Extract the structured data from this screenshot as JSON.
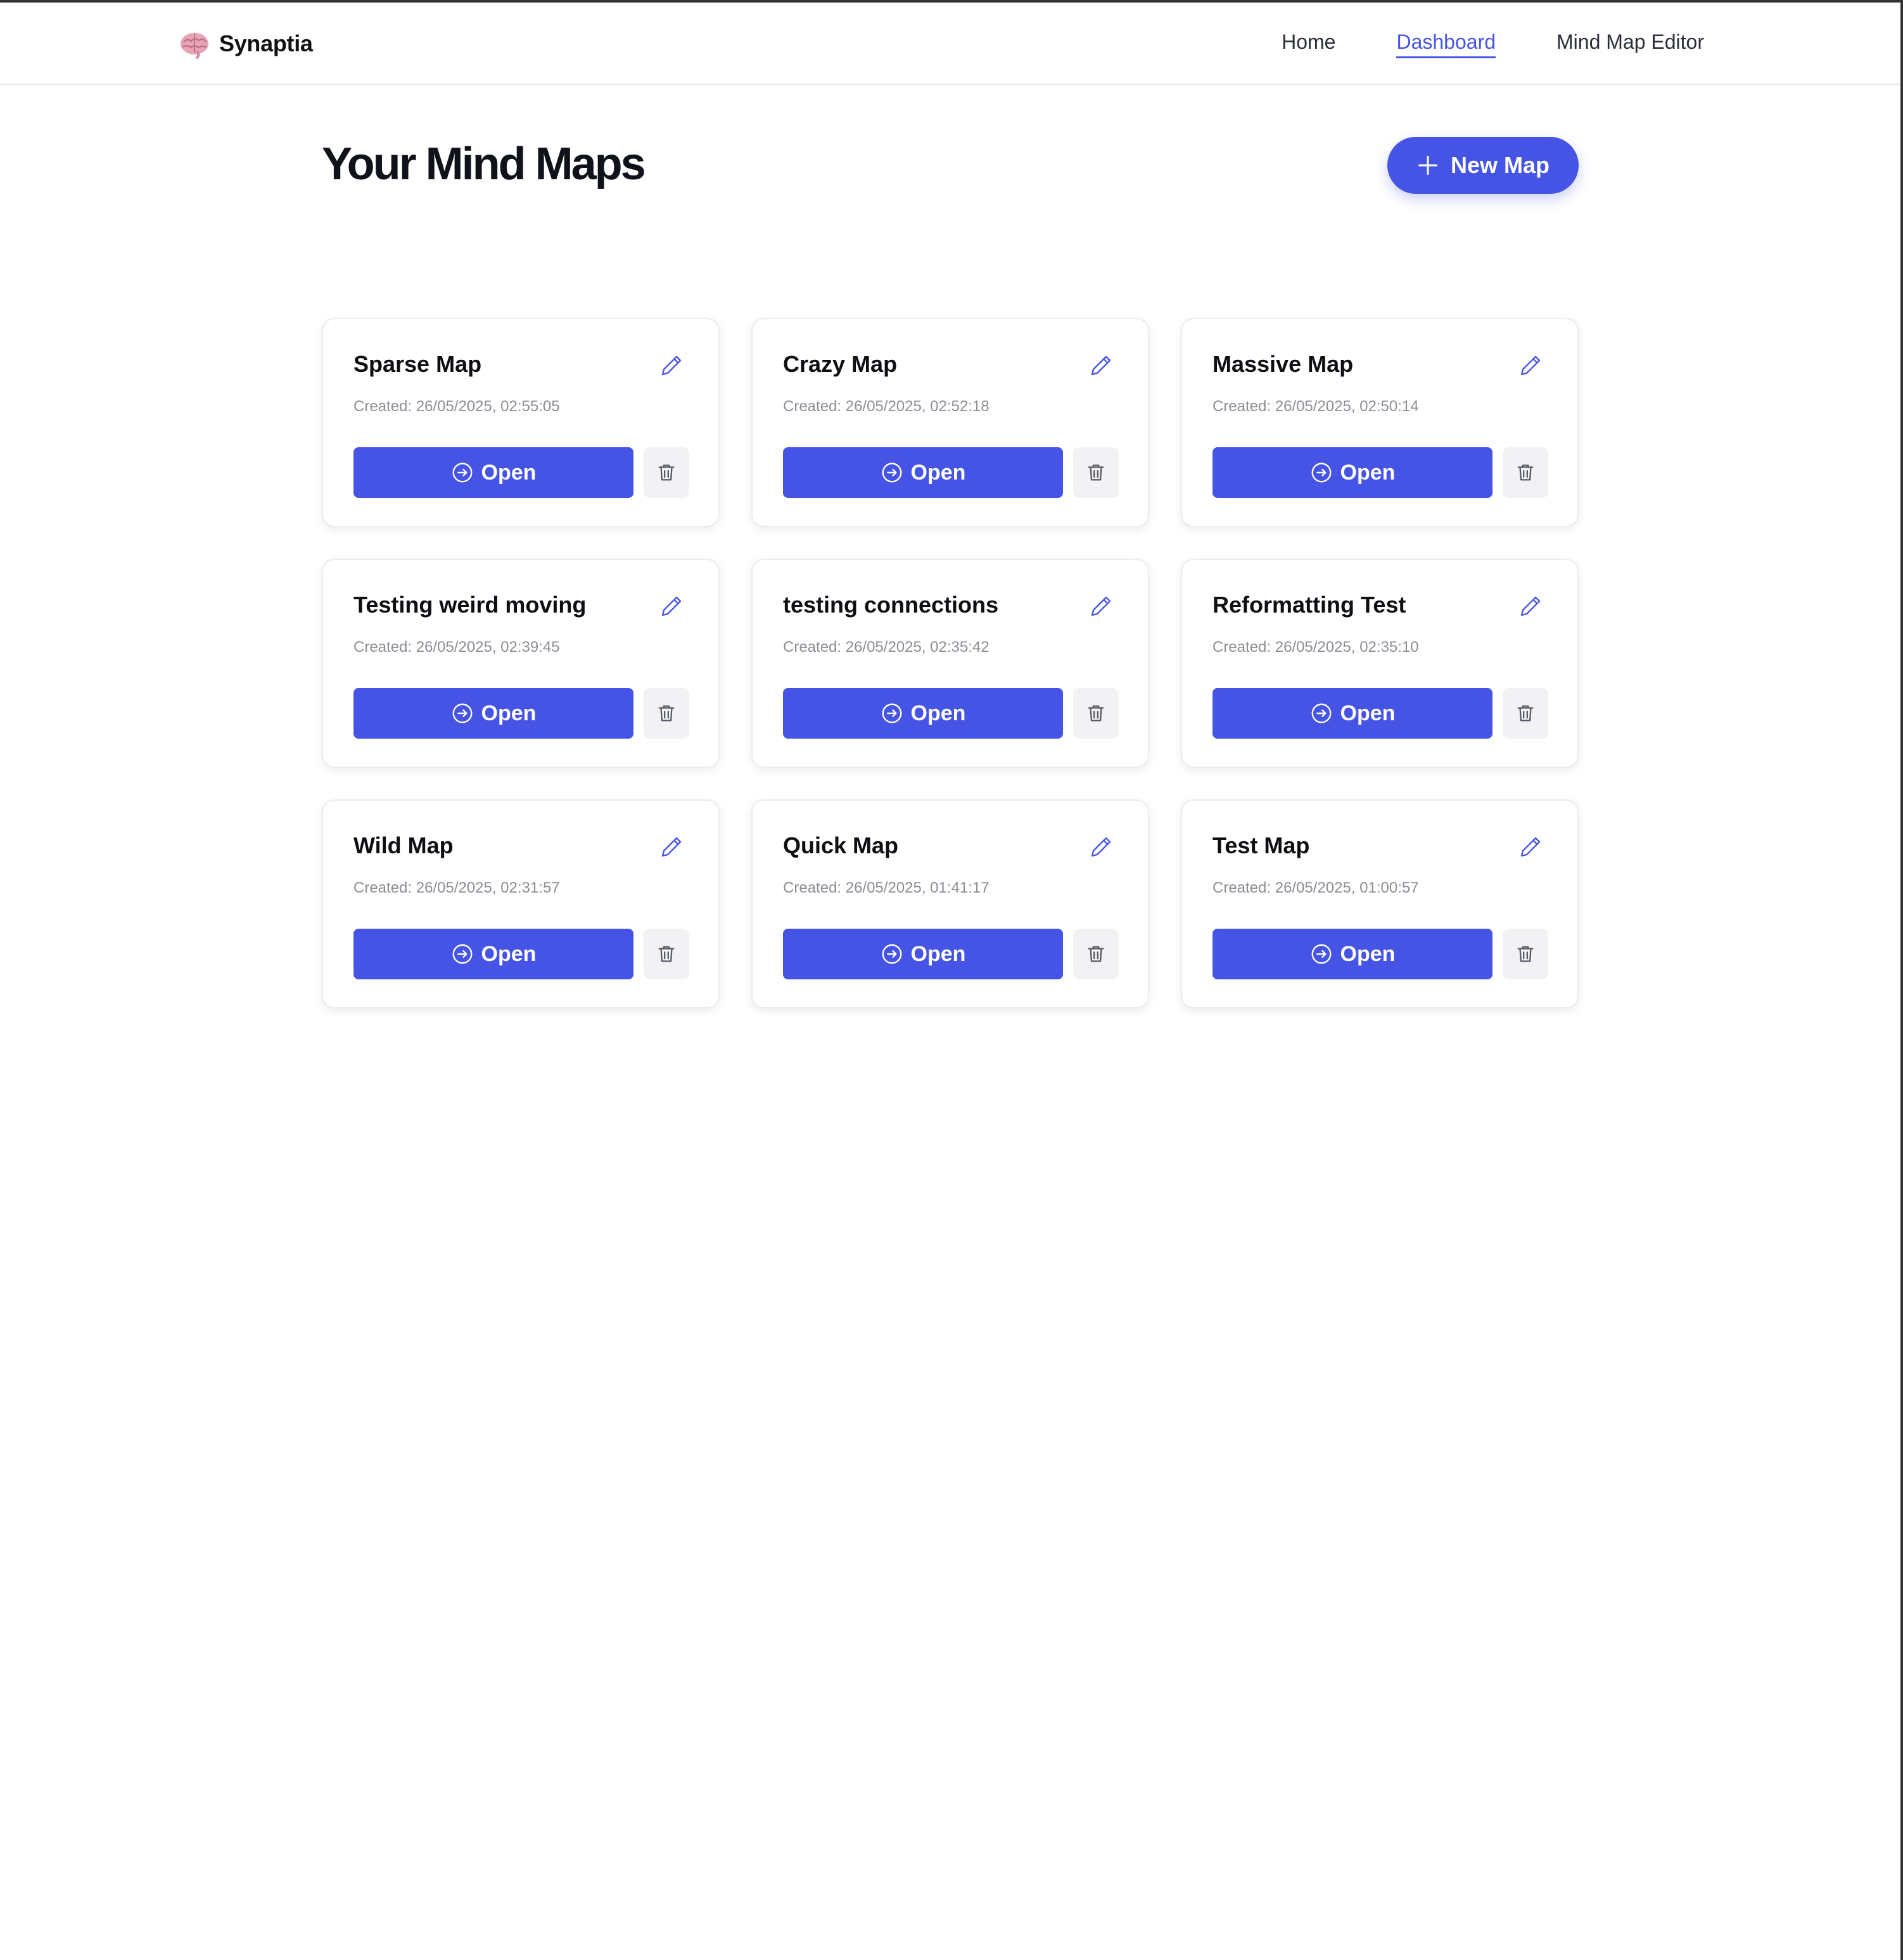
{
  "nav": {
    "brand": "Synaptia",
    "brand_icon": "brain-icon",
    "links": [
      {
        "label": "Home",
        "active": false
      },
      {
        "label": "Dashboard",
        "active": true
      },
      {
        "label": "Mind Map Editor",
        "active": false
      }
    ]
  },
  "main": {
    "title": "Your Mind Maps",
    "new_button_label": "New Map",
    "open_label": "Open",
    "maps": [
      {
        "title": "Sparse Map",
        "created": "Created: 26/05/2025, 02:55:05"
      },
      {
        "title": "Crazy Map",
        "created": "Created: 26/05/2025, 02:52:18"
      },
      {
        "title": "Massive Map",
        "created": "Created: 26/05/2025, 02:50:14"
      },
      {
        "title": "Testing weird moving",
        "created": "Created: 26/05/2025, 02:39:45"
      },
      {
        "title": "testing connections",
        "created": "Created: 26/05/2025, 02:35:42"
      },
      {
        "title": "Reformatting Test",
        "created": "Created: 26/05/2025, 02:35:10"
      },
      {
        "title": "Wild Map",
        "created": "Created: 26/05/2025, 02:31:57"
      },
      {
        "title": "Quick Map",
        "created": "Created: 26/05/2025, 01:41:17"
      },
      {
        "title": "Test Map",
        "created": "Created: 26/05/2025, 01:00:57"
      }
    ]
  },
  "colors": {
    "accent": "#4654e6",
    "delete_bg": "#f2f2f5",
    "muted_text": "#8c8e96"
  }
}
